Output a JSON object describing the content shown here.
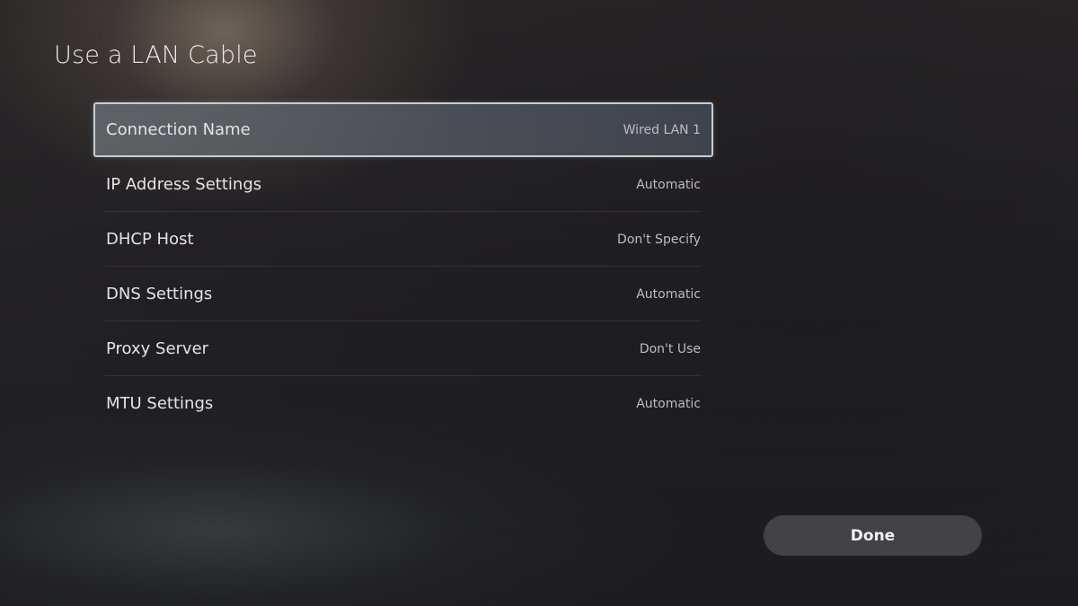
{
  "screen": {
    "title": "Use a LAN Cable"
  },
  "settings": {
    "rows": [
      {
        "label": "Connection Name",
        "value": "Wired LAN 1",
        "focused": true
      },
      {
        "label": "IP Address Settings",
        "value": "Automatic"
      },
      {
        "label": "DHCP Host",
        "value": "Don't Specify"
      },
      {
        "label": "DNS Settings",
        "value": "Automatic"
      },
      {
        "label": "Proxy Server",
        "value": "Don't Use"
      },
      {
        "label": "MTU Settings",
        "value": "Automatic"
      }
    ]
  },
  "actions": {
    "done_label": "Done"
  },
  "colors": {
    "focus_border": "#c7cdd4",
    "button_background": "#46464a",
    "text_primary": "#e4e4e4",
    "text_secondary": "#bdbdbd"
  }
}
